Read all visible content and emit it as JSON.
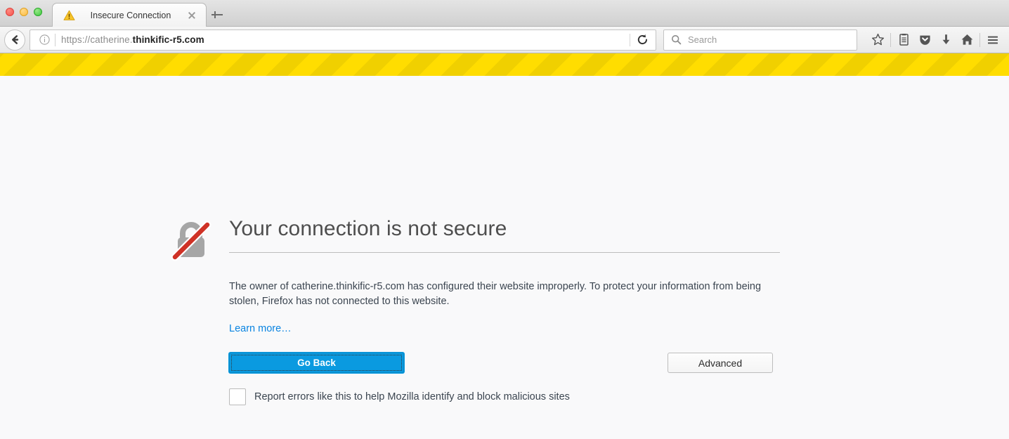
{
  "window": {
    "traffic_lights": [
      {
        "name": "close",
        "color": "#f4524d"
      },
      {
        "name": "minimize",
        "color": "#fcbc40"
      },
      {
        "name": "maximize",
        "color": "#3dc93d"
      }
    ]
  },
  "tabstrip": {
    "tab": {
      "title": "Insecure Connection",
      "favicon": "warning-triangle-icon",
      "close_icon": "close-icon"
    },
    "new_tab_icon": "plus-icon"
  },
  "navbar": {
    "back_icon": "back-arrow-icon",
    "identity_icon": "info-circle-icon",
    "url": {
      "scheme": "https://",
      "subdomain": "catherine.",
      "host": "thinkific-r5.com",
      "full": "https://catherine.thinkific-r5.com"
    },
    "reload_icon": "reload-icon",
    "search": {
      "icon": "search-icon",
      "placeholder": "Search",
      "value": ""
    },
    "icons": [
      {
        "name": "bookmark-star-icon",
        "glyph": "star"
      },
      {
        "name": "library-icon",
        "glyph": "library"
      },
      {
        "name": "pocket-icon",
        "glyph": "pocket"
      },
      {
        "name": "downloads-icon",
        "glyph": "download"
      },
      {
        "name": "home-icon",
        "glyph": "home"
      },
      {
        "name": "menu-icon",
        "glyph": "hamburger"
      }
    ]
  },
  "warning_stripes": {
    "color_a": "#ffdd00",
    "color_b": "#f0d000"
  },
  "error_page": {
    "icon": "broken-lock-icon",
    "title": "Your connection is not secure",
    "body": "The owner of catherine.thinkific-r5.com has configured their website improperly. To protect your information from being stolen, Firefox has not connected to this website.",
    "learn_more": "Learn more…",
    "primary_button": "Go Back",
    "secondary_button": "Advanced",
    "checkbox": {
      "checked": false,
      "label": "Report errors like this to help Mozilla identify and block malicious sites"
    },
    "accent_color": "#0a9ae0",
    "link_color": "#0a84e1"
  }
}
